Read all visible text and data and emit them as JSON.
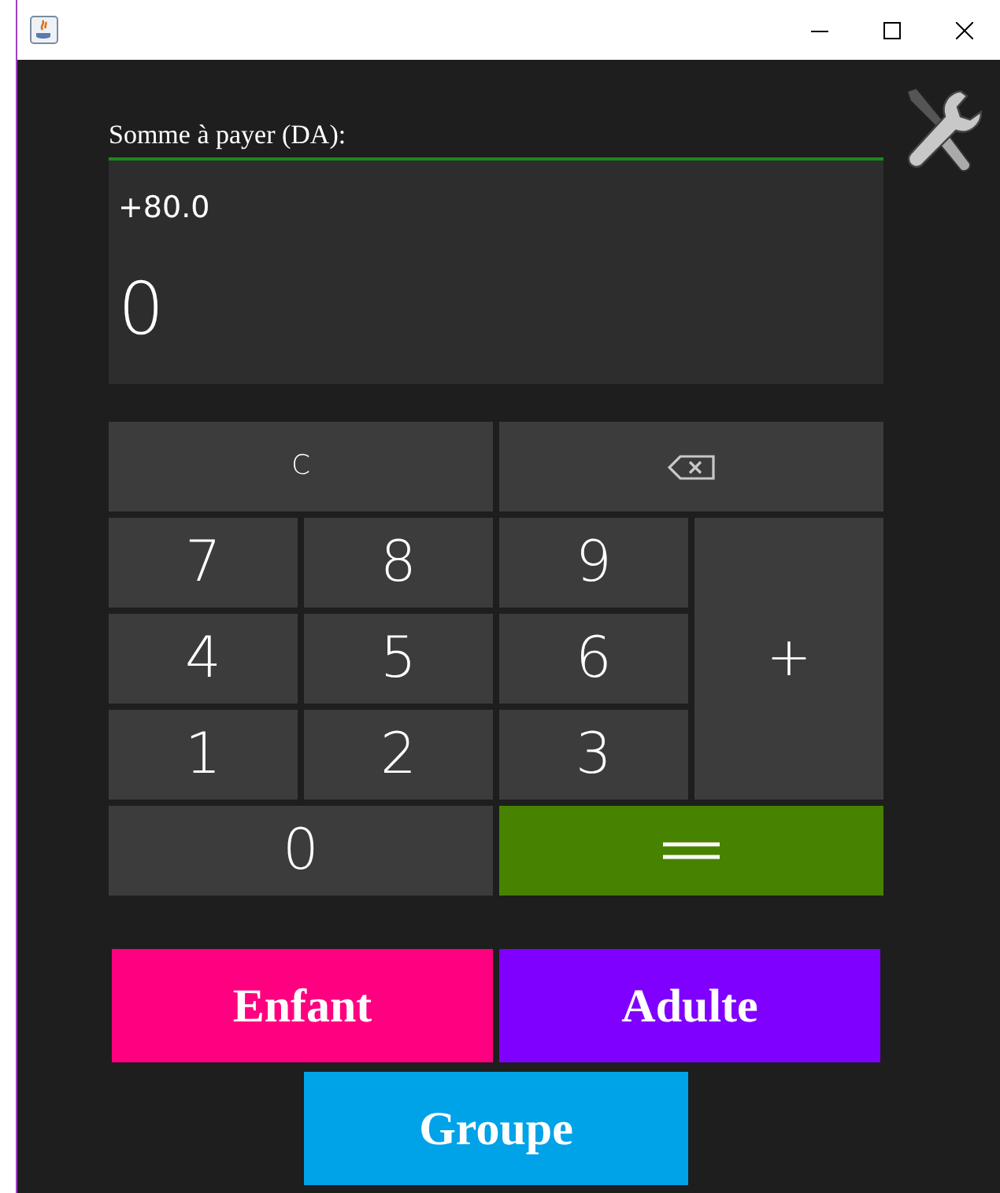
{
  "amount": {
    "label": "Somme à payer (DA):",
    "expression": "+80.0",
    "value": "0"
  },
  "keys": [
    {
      "kind": "clear",
      "label": "C",
      "wide": true
    },
    {
      "kind": "backspace",
      "wide": true
    },
    {
      "kind": "digit",
      "label": "7",
      "wide": false
    },
    {
      "kind": "digit",
      "label": "8",
      "wide": false
    },
    {
      "kind": "digit",
      "label": "9",
      "wide": false
    },
    {
      "kind": "digit",
      "label": "4",
      "wide": false
    },
    {
      "kind": "digit",
      "label": "5",
      "wide": false
    },
    {
      "kind": "digit",
      "label": "6",
      "wide": false
    },
    {
      "kind": "plus",
      "label": "+",
      "wide": false
    },
    {
      "kind": "digit",
      "label": "1",
      "wide": false
    },
    {
      "kind": "digit",
      "label": "2",
      "wide": false
    },
    {
      "kind": "digit",
      "label": "3",
      "wide": false
    },
    {
      "kind": "digit",
      "label": "0",
      "wide": true
    },
    {
      "kind": "equals",
      "wide": true
    }
  ],
  "categories": [
    {
      "label": "Enfant",
      "color": "#ff0080"
    },
    {
      "label": "Adulte",
      "color": "#8000ff"
    },
    {
      "label": "Groupe",
      "color": "#00a2e8"
    }
  ]
}
